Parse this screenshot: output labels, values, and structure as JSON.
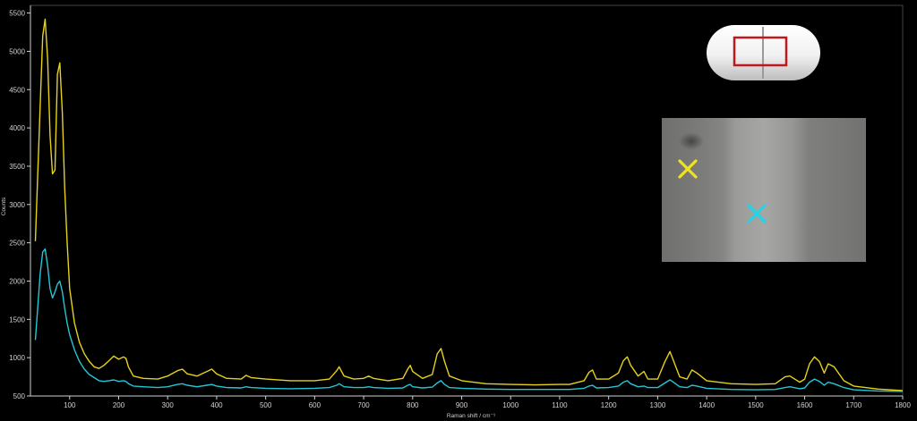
{
  "chart_data": {
    "type": "line",
    "title": "",
    "xlabel": "Raman shift / cm⁻¹",
    "ylabel": "Counts",
    "xlim": [
      20,
      1800
    ],
    "ylim": [
      500,
      5600
    ],
    "xticks": [
      100,
      200,
      300,
      400,
      500,
      600,
      700,
      800,
      900,
      1000,
      1100,
      1200,
      1300,
      1400,
      1500,
      1600,
      1700,
      1800
    ],
    "yticks": [
      500,
      1000,
      1500,
      2000,
      2500,
      3000,
      3500,
      4000,
      4500,
      5000,
      5500
    ],
    "grid": false,
    "legend": "none",
    "series": [
      {
        "color": "#e6d21a",
        "x": [
          30,
          40,
          45,
          50,
          55,
          60,
          65,
          70,
          75,
          80,
          85,
          90,
          95,
          100,
          110,
          120,
          130,
          140,
          150,
          160,
          170,
          180,
          190,
          200,
          210,
          215,
          220,
          230,
          250,
          280,
          300,
          320,
          330,
          340,
          360,
          380,
          390,
          400,
          420,
          450,
          460,
          470,
          500,
          550,
          600,
          630,
          645,
          650,
          660,
          680,
          700,
          710,
          720,
          750,
          780,
          790,
          795,
          800,
          820,
          840,
          850,
          858,
          865,
          875,
          900,
          950,
          1000,
          1050,
          1100,
          1120,
          1150,
          1160,
          1167,
          1175,
          1200,
          1220,
          1230,
          1238,
          1245,
          1260,
          1272,
          1280,
          1300,
          1315,
          1325,
          1330,
          1345,
          1360,
          1370,
          1380,
          1400,
          1450,
          1500,
          1540,
          1560,
          1570,
          1590,
          1600,
          1610,
          1620,
          1630,
          1640,
          1648,
          1660,
          1680,
          1700,
          1750,
          1800
        ],
        "y": [
          2520,
          4300,
          5200,
          5420,
          4900,
          3900,
          3400,
          3450,
          4700,
          4850,
          4200,
          3200,
          2500,
          1900,
          1450,
          1200,
          1050,
          950,
          880,
          860,
          900,
          960,
          1020,
          980,
          1010,
          990,
          880,
          760,
          730,
          720,
          760,
          830,
          850,
          790,
          760,
          820,
          850,
          790,
          730,
          720,
          770,
          740,
          720,
          700,
          700,
          720,
          830,
          880,
          760,
          720,
          730,
          760,
          730,
          700,
          730,
          850,
          900,
          820,
          730,
          780,
          1050,
          1120,
          950,
          760,
          700,
          660,
          650,
          645,
          650,
          650,
          700,
          810,
          840,
          720,
          720,
          800,
          960,
          1010,
          900,
          760,
          820,
          720,
          720,
          950,
          1080,
          1000,
          750,
          720,
          840,
          800,
          700,
          660,
          650,
          660,
          750,
          760,
          680,
          720,
          920,
          1010,
          950,
          800,
          920,
          880,
          700,
          630,
          590,
          570
        ]
      },
      {
        "color": "#22c7d6",
        "x": [
          30,
          40,
          45,
          50,
          55,
          60,
          65,
          70,
          75,
          80,
          85,
          90,
          95,
          100,
          110,
          120,
          130,
          140,
          150,
          160,
          170,
          180,
          190,
          200,
          210,
          215,
          220,
          230,
          250,
          280,
          300,
          320,
          330,
          340,
          360,
          380,
          390,
          400,
          420,
          450,
          460,
          470,
          500,
          550,
          600,
          630,
          645,
          650,
          660,
          680,
          700,
          710,
          720,
          750,
          780,
          790,
          795,
          800,
          820,
          840,
          850,
          858,
          865,
          875,
          900,
          950,
          1000,
          1050,
          1100,
          1120,
          1150,
          1160,
          1167,
          1175,
          1200,
          1220,
          1230,
          1238,
          1245,
          1260,
          1272,
          1280,
          1300,
          1315,
          1325,
          1330,
          1345,
          1360,
          1370,
          1380,
          1400,
          1450,
          1500,
          1540,
          1560,
          1570,
          1590,
          1600,
          1610,
          1620,
          1630,
          1640,
          1648,
          1660,
          1680,
          1700,
          1750,
          1800
        ],
        "y": [
          1230,
          2100,
          2380,
          2420,
          2200,
          1900,
          1780,
          1860,
          1960,
          2000,
          1860,
          1640,
          1450,
          1300,
          1100,
          950,
          850,
          780,
          740,
          700,
          690,
          700,
          710,
          690,
          700,
          690,
          660,
          630,
          620,
          610,
          620,
          650,
          660,
          640,
          620,
          640,
          650,
          630,
          610,
          605,
          620,
          610,
          600,
          595,
          600,
          610,
          640,
          660,
          620,
          610,
          610,
          620,
          610,
          600,
          605,
          640,
          650,
          620,
          605,
          615,
          670,
          700,
          650,
          610,
          600,
          590,
          585,
          585,
          585,
          585,
          600,
          630,
          640,
          605,
          610,
          630,
          680,
          700,
          660,
          620,
          630,
          610,
          610,
          670,
          710,
          690,
          620,
          610,
          640,
          630,
          600,
          585,
          580,
          585,
          610,
          620,
          595,
          605,
          680,
          720,
          690,
          640,
          680,
          660,
          610,
          580,
          565,
          560
        ]
      }
    ]
  },
  "inset": {
    "tablet_marker_color": "#c0181a",
    "marker_yellow_color": "#f1e21c",
    "marker_cyan_color": "#22d4e6"
  }
}
